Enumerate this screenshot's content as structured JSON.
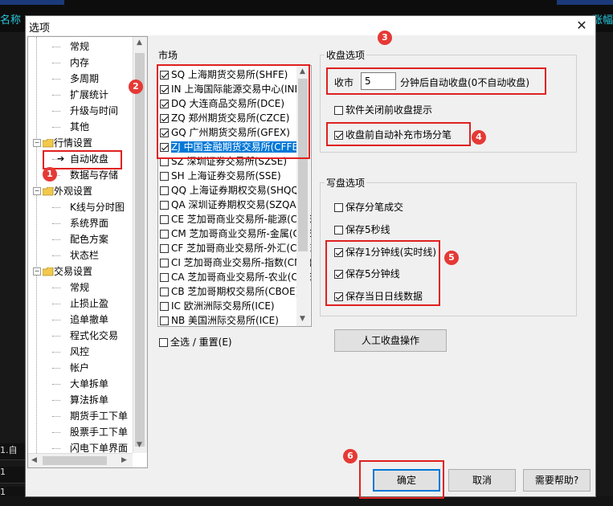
{
  "background": {
    "left_tab": "名称",
    "right_tab": "涨幅",
    "left_rows": [
      "1.自",
      "1",
      "1"
    ]
  },
  "dialog": {
    "title": "选项",
    "close_glyph": "✕"
  },
  "tree": {
    "items": [
      {
        "label": "常规",
        "level": 2
      },
      {
        "label": "内存",
        "level": 2
      },
      {
        "label": "多周期",
        "level": 2
      },
      {
        "label": "扩展统计",
        "level": 2
      },
      {
        "label": "升级与时间",
        "level": 2
      },
      {
        "label": "其他",
        "level": 2
      },
      {
        "label": "行情设置",
        "level": 1
      },
      {
        "label": "自动收盘",
        "level": 2,
        "selected": true
      },
      {
        "label": "数据与存储",
        "level": 2
      },
      {
        "label": "外观设置",
        "level": 1
      },
      {
        "label": "K线与分时图",
        "level": 2
      },
      {
        "label": "系统界面",
        "level": 2
      },
      {
        "label": "配色方案",
        "level": 2
      },
      {
        "label": "状态栏",
        "level": 2
      },
      {
        "label": "交易设置",
        "level": 1
      },
      {
        "label": "常规",
        "level": 2
      },
      {
        "label": "止损止盈",
        "level": 2
      },
      {
        "label": "追单撤单",
        "level": 2
      },
      {
        "label": "程式化交易",
        "level": 2
      },
      {
        "label": "风控",
        "level": 2
      },
      {
        "label": "帐户",
        "level": 2
      },
      {
        "label": "大单拆单",
        "level": 2
      },
      {
        "label": "算法拆单",
        "level": 2
      },
      {
        "label": "期货手工下单",
        "level": 2
      },
      {
        "label": "股票手工下单",
        "level": 2
      },
      {
        "label": "闪电下单界面",
        "level": 2
      }
    ]
  },
  "market": {
    "label": "市场",
    "items": [
      {
        "label": "SQ 上海期货交易所(SHFE)",
        "checked": true
      },
      {
        "label": "IN 上海国际能源交易中心(INE)",
        "checked": true
      },
      {
        "label": "DQ 大连商品交易所(DCE)",
        "checked": true
      },
      {
        "label": "ZQ 郑州期货交易所(CZCE)",
        "checked": true
      },
      {
        "label": "GQ 广州期货交易所(GFEX)",
        "checked": true
      },
      {
        "label": "ZJ 中国金融期货交易所(CFFEX)",
        "checked": true,
        "selected": true
      },
      {
        "label": "SZ 深圳证券交易所(SZSE)",
        "checked": false
      },
      {
        "label": "SH 上海证券交易所(SSE)",
        "checked": false
      },
      {
        "label": "QQ 上海证券期权交易(SHQQ)",
        "checked": false
      },
      {
        "label": "QA 深圳证券期权交易(SZQA)",
        "checked": false
      },
      {
        "label": "CE 芝加哥商业交易所-能源(CME)",
        "checked": false
      },
      {
        "label": "CM 芝加哥商业交易所-金属(CME)",
        "checked": false
      },
      {
        "label": "CF 芝加哥商业交易所-外汇(CME)",
        "checked": false
      },
      {
        "label": "CI 芝加哥商业交易所-指数(CME)",
        "checked": false
      },
      {
        "label": "CA 芝加哥商业交易所-农业(CME)",
        "checked": false
      },
      {
        "label": "CB 芝加哥期权交易所(CBOE)",
        "checked": false
      },
      {
        "label": "IC 欧洲洲际交易所(ICE)",
        "checked": false
      },
      {
        "label": "NB 美国洲际交易所(ICE)",
        "checked": false
      }
    ],
    "select_all_label": "全选 / 重置(E)"
  },
  "close_options": {
    "label": "收盘选项",
    "close_prefix": "收市",
    "close_minutes": "5",
    "close_suffix": "分钟后自动收盘(0不自动收盘)",
    "software_close_prompt": "软件关闭前收盘提示",
    "auto_fill_ticks": "收盘前自动补充市场分笔"
  },
  "write_options": {
    "label": "写盘选项",
    "save_ticks": "保存分笔成交",
    "save_5s": "保存5秒线",
    "save_1min": "保存1分钟线(实时线)",
    "save_5min": "保存5分钟线",
    "save_daily": "保存当日日线数据"
  },
  "buttons": {
    "manual_close": "人工收盘操作",
    "ok": "确定",
    "cancel": "取消",
    "help": "需要帮助?"
  },
  "badges": [
    "1",
    "2",
    "3",
    "4",
    "5",
    "6"
  ],
  "colors": {
    "annotation_red": "#e02020",
    "selection_blue": "#0078d7",
    "accent_cyan": "#28c8e0"
  }
}
